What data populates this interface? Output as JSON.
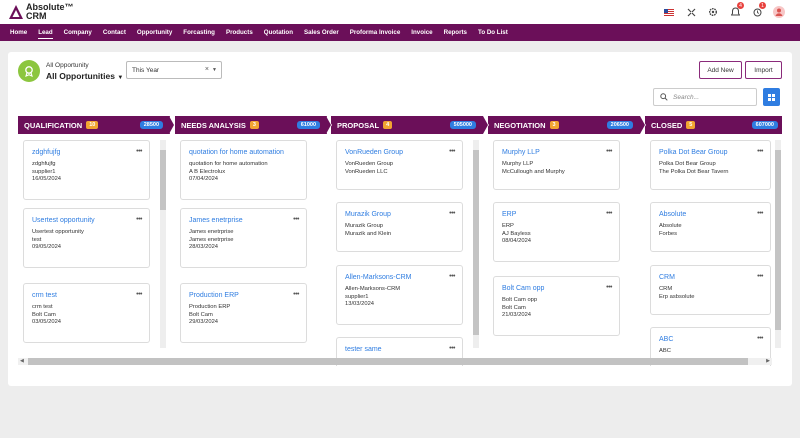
{
  "app": {
    "logo_line1": "Absolute™",
    "logo_line2": "CRM"
  },
  "header_icons": [
    {
      "name": "flag-icon",
      "badge": ""
    },
    {
      "name": "collapse-icon",
      "badge": ""
    },
    {
      "name": "gear-icon",
      "badge": ""
    },
    {
      "name": "notification-icon",
      "badge": "4"
    },
    {
      "name": "reminder-icon",
      "badge": "1"
    },
    {
      "name": "user-avatar-icon",
      "badge": ""
    }
  ],
  "nav": [
    "Home",
    "Lead",
    "Company",
    "Contact",
    "Opportunity",
    "Forcasting",
    "Products",
    "Quotation",
    "Sales Order",
    "Proforma Invoice",
    "Invoice",
    "Reports",
    "To Do List"
  ],
  "nav_active": "Lead",
  "toolbar": {
    "subtitle": "All Opportunity",
    "title": "All Opportunities",
    "period_value": "This Year",
    "add_new": "Add New",
    "import": "Import",
    "search_placeholder": "Search..."
  },
  "colors": {
    "accent": "#6b0f59",
    "link": "#2f7de1",
    "badge": "#f2a531",
    "icon": "#8cc63f"
  },
  "columns": [
    {
      "title": "QUALIFICATION",
      "count": "10",
      "amount": "28500",
      "cards": [
        {
          "title": "zdghfujfg",
          "line1": "zdghfujfg",
          "line2": "supplier1",
          "date": "16/05/2024"
        },
        {
          "title": "Usertest opportunity",
          "line1": "Usertest opportunity",
          "line2": "test",
          "date": "09/05/2024"
        },
        {
          "title": "crm test",
          "line1": "crm test",
          "line2": "Bolt Cam",
          "date": "03/05/2024"
        }
      ]
    },
    {
      "title": "NEEDS ANALYSIS",
      "count": "3",
      "amount": "61000",
      "cards": [
        {
          "title": "quotation for home automation",
          "line1": "quotation for home automation",
          "line2": "A B Electrolux",
          "date": "07/04/2024"
        },
        {
          "title": "James enetrprise",
          "line1": "James enetrprise",
          "line2": "James enetrprise",
          "date": "28/03/2024"
        },
        {
          "title": "Production ERP",
          "line1": "Production ERP",
          "line2": "Bolt Cam",
          "date": "29/03/2024"
        }
      ]
    },
    {
      "title": "PROPOSAL",
      "count": "4",
      "amount": "505000",
      "cards": [
        {
          "title": "VonRueden Group",
          "line1": "VonRueden Group",
          "line2": "VonRueden LLC",
          "date": ""
        },
        {
          "title": "Murazik Group",
          "line1": "Murazik Group",
          "line2": "Murazik and Klein",
          "date": ""
        },
        {
          "title": "Allen-Marksons-CRM",
          "line1": "Allen-Marksons-CRM",
          "line2": "supplier1",
          "date": "13/03/2024"
        },
        {
          "title": "tester same",
          "line1": "",
          "line2": "",
          "date": ""
        }
      ]
    },
    {
      "title": "NEGOTIATION",
      "count": "3",
      "amount": "206500",
      "cards": [
        {
          "title": "Murphy LLP",
          "line1": "Murphy LLP",
          "line2": "McCullough and Murphy",
          "date": ""
        },
        {
          "title": "ERP",
          "line1": "ERP",
          "line2": "AJ Bayless",
          "date": "08/04/2024"
        },
        {
          "title": "Bolt Cam opp",
          "line1": "Bolt Cam opp",
          "line2": "Bolt Cam",
          "date": "21/03/2024"
        }
      ]
    },
    {
      "title": "CLOSED",
      "count": "5",
      "amount": "607000",
      "cards": [
        {
          "title": "Polka Dot Bear Group",
          "line1": "Polka Dot Bear Group",
          "line2": "The Polka Dot Bear Tavern",
          "date": ""
        },
        {
          "title": "Absolute",
          "line1": "Absolute",
          "line2": "Forbes",
          "date": ""
        },
        {
          "title": "CRM",
          "line1": "CRM",
          "line2": "Erp asbsolute",
          "date": ""
        },
        {
          "title": "ABC",
          "line1": "ABC",
          "line2": "",
          "date": ""
        }
      ]
    }
  ]
}
